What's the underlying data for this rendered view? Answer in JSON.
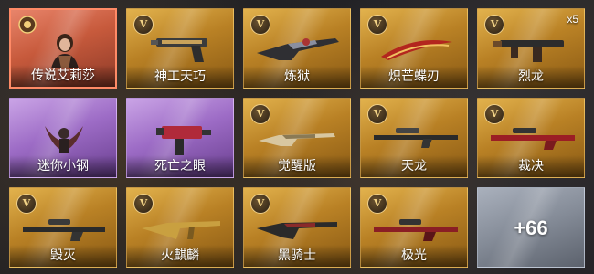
{
  "items": [
    {
      "name": "传说艾莉莎",
      "badge": "",
      "count": ""
    },
    {
      "name": "神工天巧",
      "badge": "V",
      "count": ""
    },
    {
      "name": "炼狱",
      "badge": "V",
      "count": ""
    },
    {
      "name": "炽芒蝶刃",
      "badge": "V",
      "count": ""
    },
    {
      "name": "烈龙",
      "badge": "V",
      "count": "x5"
    },
    {
      "name": "迷你小钢",
      "badge": "",
      "count": ""
    },
    {
      "name": "死亡之眼",
      "badge": "",
      "count": ""
    },
    {
      "name": "觉醒版",
      "badge": "V",
      "count": ""
    },
    {
      "name": "天龙",
      "badge": "V",
      "count": ""
    },
    {
      "name": "裁决",
      "badge": "V",
      "count": ""
    },
    {
      "name": "毁灭",
      "badge": "V",
      "count": ""
    },
    {
      "name": "火麒麟",
      "badge": "V",
      "count": ""
    },
    {
      "name": "黑骑士",
      "badge": "V",
      "count": ""
    },
    {
      "name": "极光",
      "badge": "V",
      "count": ""
    }
  ],
  "more_tile": {
    "label": "+66"
  }
}
